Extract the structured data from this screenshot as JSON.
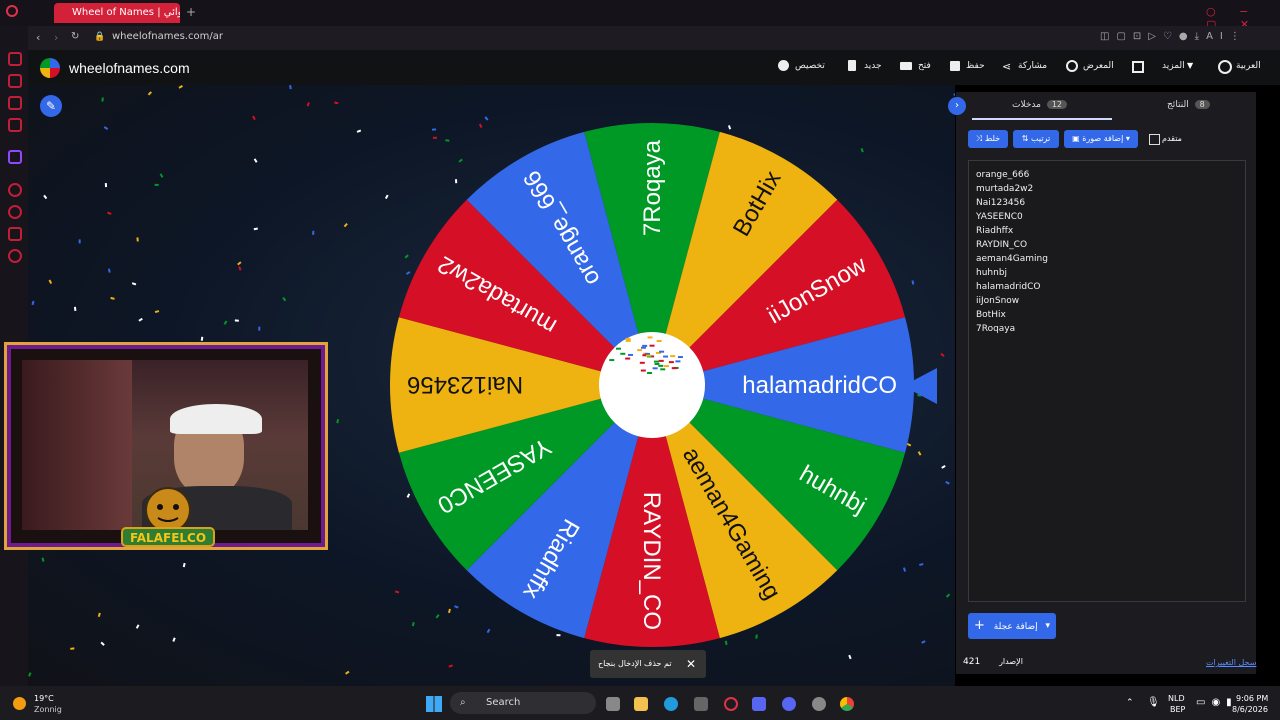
{
  "browser": {
    "tab_title": "Wheel of Names | عجلة الأسماء العشوائي",
    "url": "wheelofnames.com/ar"
  },
  "site": {
    "name": "wheelofnames.com",
    "nav": {
      "language": "العربية",
      "more": "المزيد",
      "gallery": "المعرض",
      "share": "مشاركة",
      "save": "حفظ",
      "open": "فتح",
      "new": "جديد",
      "customize": "تخصيص"
    }
  },
  "panel": {
    "tabs": [
      {
        "label": "مدخلات",
        "count": "12"
      },
      {
        "label": "النتائج",
        "count": "8"
      }
    ],
    "buttons": {
      "shuffle": "خلط",
      "sort": "ترتيب",
      "add_image": "إضافة صورة",
      "advanced": "متقدم"
    },
    "entries": [
      "orange_666",
      "murtada2w2",
      "Nai123456",
      "YASEENC0",
      "Riadhffx",
      "RAYDIN_CO",
      "aeman4Gaming",
      "huhnbj",
      "halamadridCO",
      "iiJonSnow",
      "BotHix",
      "7Roqaya"
    ],
    "add_wheel": "إضافة عجلة",
    "version_label": "الإصدار",
    "version": "421",
    "changelog": "سجل التغييرات"
  },
  "wheel": {
    "colors": [
      "#3369e8",
      "#d50f25",
      "#eeb211",
      "#009925"
    ],
    "segments": [
      "7Roqaya",
      "BotHix",
      "iiJonSnow",
      "halamadridCO",
      "huhnbj",
      "aeman4Gaming",
      "RAYDIN_CO",
      "Riadhffx",
      "YASEENC0",
      "Nai123456",
      "murtada2w2",
      "orange_666"
    ]
  },
  "toast": {
    "text": "تم حذف الإدخال بنجاح"
  },
  "webcam": {
    "label": "FALAFELCO"
  },
  "taskbar": {
    "weather_temp": "19°C",
    "weather_desc": "Zonnig",
    "search": "Search",
    "lang1": "NLD",
    "lang2": "BEP",
    "time": "9:06 PM",
    "date": "8/6/2026"
  }
}
